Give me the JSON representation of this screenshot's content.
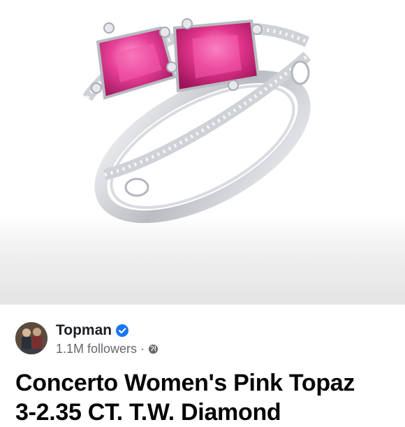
{
  "post": {
    "image_alt": "Pink topaz two-stone ring",
    "page_name": "Topman",
    "followers": "1.1M followers",
    "separator": "·",
    "title_line1": "Concerto Women's Pink Topaz",
    "title_line2": "3-2.35 CT. T.W. Diamond"
  },
  "icons": {
    "verified": "verified-badge-icon",
    "audience": "globe-icon"
  },
  "colors": {
    "verified": "#1877f2",
    "gem": "#e0358f",
    "metal": "#c9ccd2"
  }
}
